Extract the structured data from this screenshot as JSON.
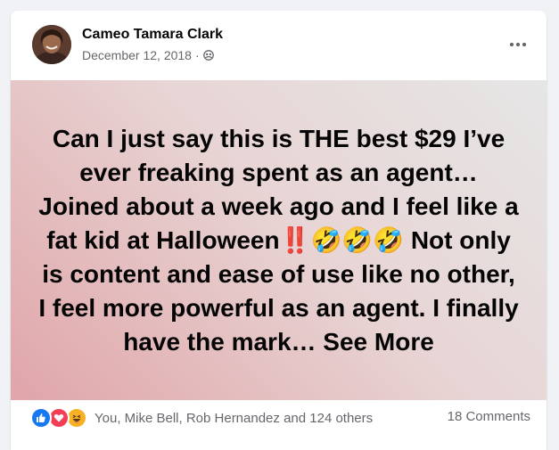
{
  "post": {
    "author": "Cameo Tamara Clark",
    "date": "December 12, 2018",
    "separator": "·",
    "privacy_icon": "friends-icon",
    "text": "Can I just say this is THE best $29 I’ve ever freaking spent as an agent… Joined about a week ago and I feel like a fat kid at Halloween‼️🤣🤣🤣 Not only is content and ease of use like no other, I feel more powerful as an agent. I finally have the mark… See More",
    "background_colors": [
      "#e6e6e6",
      "#e8d5d5",
      "#e0a5a8"
    ]
  },
  "footer": {
    "reaction_icons": [
      "like-icon",
      "love-icon",
      "haha-icon"
    ],
    "reaction_names": "You, Mike Bell, Rob Hernandez and 124 others",
    "comments": "18 Comments"
  },
  "colors": {
    "like": "#1877f2",
    "love": "#f33e58",
    "haha": "#f7b125",
    "secondary_text": "#65676b"
  }
}
